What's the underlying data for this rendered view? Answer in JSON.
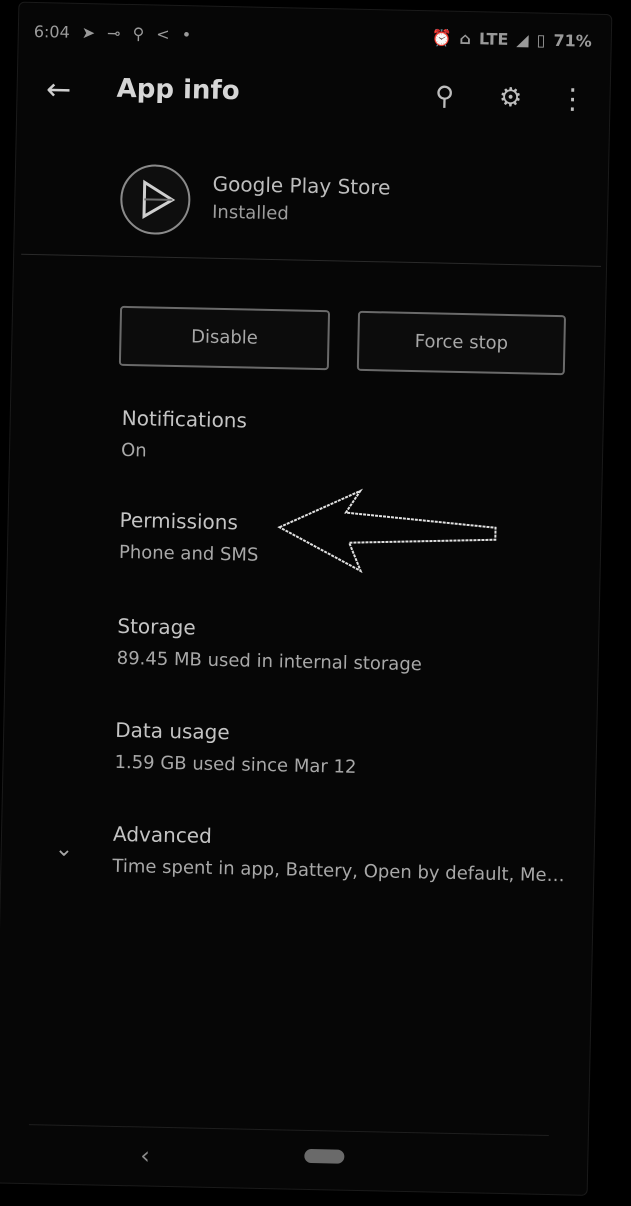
{
  "status_bar": {
    "time": "6:04",
    "left_icons": [
      "navigation-icon",
      "link-icon",
      "person-icon",
      "share-icon",
      "dot-icon"
    ],
    "right_icons": [
      "alarm-icon",
      "hotspot-icon"
    ],
    "network": "LTE",
    "battery": "71%"
  },
  "app_bar": {
    "title": "App info"
  },
  "app": {
    "name": "Google Play Store",
    "status": "Installed"
  },
  "buttons": {
    "disable": "Disable",
    "force_stop": "Force stop"
  },
  "rows": [
    {
      "title": "Notifications",
      "subtitle": "On"
    },
    {
      "title": "Permissions",
      "subtitle": "Phone and SMS"
    },
    {
      "title": "Storage",
      "subtitle": "89.45 MB used in internal storage"
    },
    {
      "title": "Data usage",
      "subtitle": "1.59 GB used since Mar 12"
    },
    {
      "title": "Advanced",
      "subtitle": "Time spent in app, Battery, Open by default, Memor.."
    }
  ]
}
